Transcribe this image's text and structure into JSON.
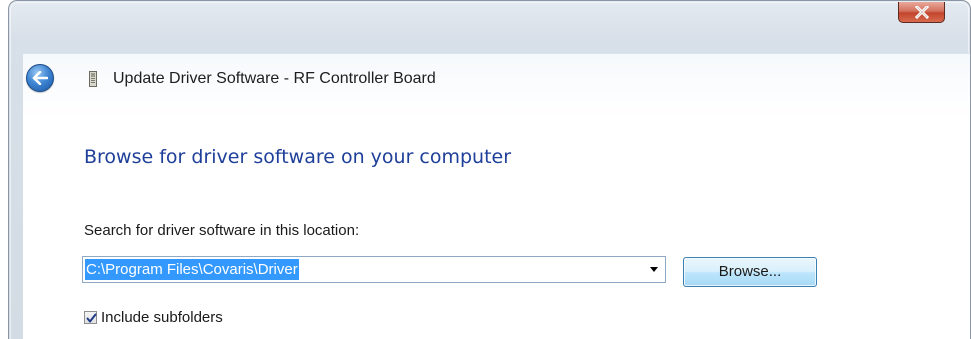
{
  "window": {
    "title": "Update Driver Software - RF Controller Board",
    "close_symbol": "x"
  },
  "icons": {
    "back": "back-arrow-icon",
    "device": "device-board-icon",
    "dropdown": "chevron-down-icon",
    "checkmark": "checkmark-icon"
  },
  "page": {
    "heading": "Browse for driver software on your computer",
    "search_label": "Search for driver software in this location:",
    "path_value": "C:\\Program Files\\Covaris\\Driver",
    "browse_label": "Browse...",
    "include_subfolders_label": "Include subfolders",
    "include_subfolders_checked": true
  },
  "colors": {
    "heading": "#1e3f9a",
    "selection": "#3399ff",
    "close_button": "#c2452c"
  }
}
